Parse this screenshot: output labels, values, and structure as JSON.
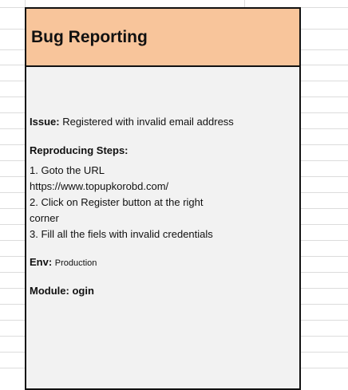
{
  "card": {
    "title": "Bug Reporting",
    "header_color": "#f8c59b",
    "body_color": "#f2f2f2",
    "issue": {
      "label": "Issue:",
      "value": "Registered with invalid email address"
    },
    "steps": {
      "heading": "Reproducing Steps:",
      "lines": [
        "1. Goto the URL",
        "https://www.topupkorobd.com/",
        "2. Click on Register button at the right",
        "corner",
        "3. Fill all the fiels with invalid credentials"
      ]
    },
    "env": {
      "label": "Env:",
      "value": "Production"
    },
    "module": {
      "label": "Module:",
      "value": "ogin"
    }
  }
}
